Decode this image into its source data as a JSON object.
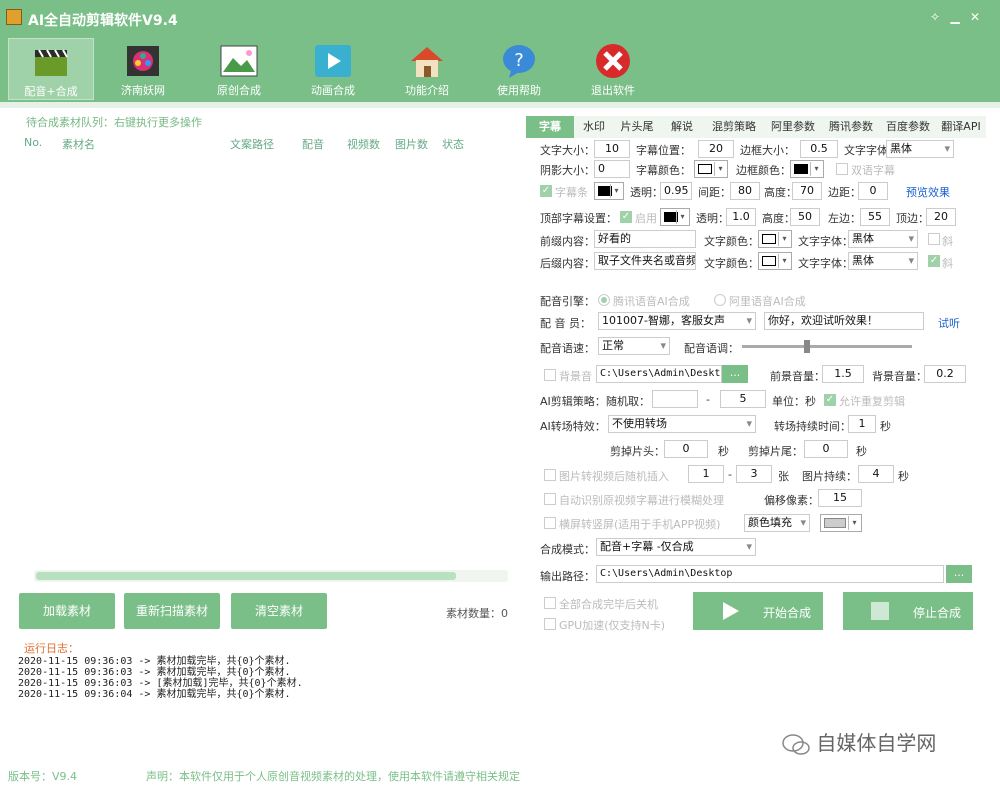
{
  "window": {
    "title": "AI全自动剪辑软件V9.4"
  },
  "toolbar": [
    {
      "label": "配音+合成",
      "icon": "clapperboard-icon"
    },
    {
      "label": "济南妖网",
      "icon": "film-reel-icon"
    },
    {
      "label": "原创合成",
      "icon": "picture-icon"
    },
    {
      "label": "动画合成",
      "icon": "play-video-icon"
    },
    {
      "label": "功能介绍",
      "icon": "house-icon"
    },
    {
      "label": "使用帮助",
      "icon": "question-bubble-icon"
    },
    {
      "label": "退出软件",
      "icon": "exit-x-icon"
    }
  ],
  "queue": {
    "hint": "待合成素材队列：右键执行更多操作",
    "columns": [
      "No.",
      "素材名",
      "文案路径",
      "配音",
      "视频数",
      "图片数",
      "状态"
    ]
  },
  "left_buttons": [
    "加载素材",
    "重新扫描素材",
    "清空素材"
  ],
  "material_count": "素材数量：0",
  "log": {
    "header": "运行日志：",
    "lines": [
      "2020-11-15 09:36:03 -> 素材加载完毕，共{0}个素材.",
      "2020-11-15 09:36:03 -> 素材加载完毕，共{0}个素材.",
      "2020-11-15 09:36:03 -> [素材加载]完毕，共{0}个素材.",
      "2020-11-15 09:36:04 -> 素材加载完毕，共{0}个素材."
    ]
  },
  "tabs": [
    "字幕",
    "水印",
    "片头尾",
    "解说",
    "混剪策略",
    "阿里参数",
    "腾讯参数",
    "百度参数",
    "翻译API"
  ],
  "subtitle": {
    "font_size_label": "文字大小：",
    "font_size": "10",
    "pos_label": "字幕位置：",
    "pos": "20",
    "border_size_label": "边框大小：",
    "border_size": "0.5",
    "font_label": "文字字体：",
    "font": "黑体",
    "shadow_label": "阴影大小：",
    "shadow": "0",
    "color_label": "字幕颜色：",
    "border_color_label": "边框颜色：",
    "bilingual_label": "双语字幕",
    "bar_label": "字幕条",
    "opacity_label": "透明：",
    "opacity": "0.95",
    "gap_label": "间距：",
    "gap": "80",
    "height_label": "高度：",
    "height": "70",
    "margin_label": "边距：",
    "margin": "0",
    "preview_label": "预览效果",
    "top_label": "顶部字幕设置：",
    "enable_label": "启用",
    "top_opacity_label": "透明：",
    "top_opacity": "1.0",
    "top_height_label": "高度：",
    "top_height": "50",
    "left_label": "左边：",
    "left": "55",
    "topedge_label": "顶边：",
    "topedge": "20",
    "prefix_label": "前缀内容：",
    "prefix": "好看的",
    "prefix_color_label": "文字颜色：",
    "prefix_font_label": "文字字体：",
    "prefix_font": "黑体",
    "italic_label": "斜",
    "suffix_label": "后缀内容：",
    "suffix": "取子文件夹名或音频",
    "suffix_color_label": "文字颜色：",
    "suffix_font_label": "文字字体：",
    "suffix_font": "黑体",
    "italic2_label": "斜"
  },
  "voice": {
    "engine_label": "配音引擎：",
    "engine_tencent": "腾讯语音AI合成",
    "engine_ali": "阿里语音AI合成",
    "speaker_label": "配 音 员：",
    "speaker": "101007-智娜，客服女声",
    "test_text": "你好，欢迎试听效果！",
    "try_label": "试听",
    "speed_label": "配音语速：",
    "speed": "正常",
    "tone_label": "配音语调："
  },
  "bgm": {
    "label": "背景音",
    "path": "C:\\Users\\Admin\\Desktop",
    "browse": "...",
    "fg_vol_label": "前景音量：",
    "fg_vol": "1.5",
    "bg_vol_label": "背景音量：",
    "bg_vol": "0.2"
  },
  "strategy": {
    "label": "AI剪辑策略：",
    "random_label": "随机取：",
    "dash": "-",
    "to": "5",
    "unit_label": "单位：秒",
    "allow_repeat": "允许重复剪辑"
  },
  "transition": {
    "label": "AI转场特效：",
    "value": "不使用转场",
    "duration_label": "转场持续时间：",
    "duration": "1",
    "sec": "秒"
  },
  "trim": {
    "head_label": "剪掉片头：",
    "head": "0",
    "sec1": "秒",
    "tail_label": "剪掉片尾：",
    "tail": "0",
    "sec2": "秒"
  },
  "image_insert": {
    "label": "图片转视频后随机插入",
    "from": "1",
    "dash": "-",
    "to": "3",
    "unit": "张",
    "dur_label": "图片持续：",
    "dur": "4",
    "sec": "秒"
  },
  "blur": {
    "label": "自动识别原视频字幕进行模糊处理",
    "offset_label": "偏移像素：",
    "offset": "15"
  },
  "portrait": {
    "label": "横屏转竖屏(适用于手机APP视频)",
    "fill": "颜色填充"
  },
  "compose": {
    "mode_label": "合成模式：",
    "mode": "配音+字幕 -仅合成"
  },
  "output": {
    "label": "输出路径：",
    "path": "C:\\Users\\Admin\\Desktop",
    "browse": "..."
  },
  "options": {
    "shutdown": "全部合成完毕后关机",
    "gpu": "GPU加速(仅支持N卡)"
  },
  "actions": {
    "start": "开始合成",
    "stop": "停止合成"
  },
  "footer": {
    "version": "版本号：V9.4",
    "disclaimer": "声明：本软件仅用于个人原创音视频素材的处理，使用本软件请遵守相关规定"
  },
  "watermark": "自媒体自学网",
  "colors": {
    "primary": "#7bbf88",
    "accent_blue": "#1a5fd0",
    "log_header": "#e07030"
  }
}
